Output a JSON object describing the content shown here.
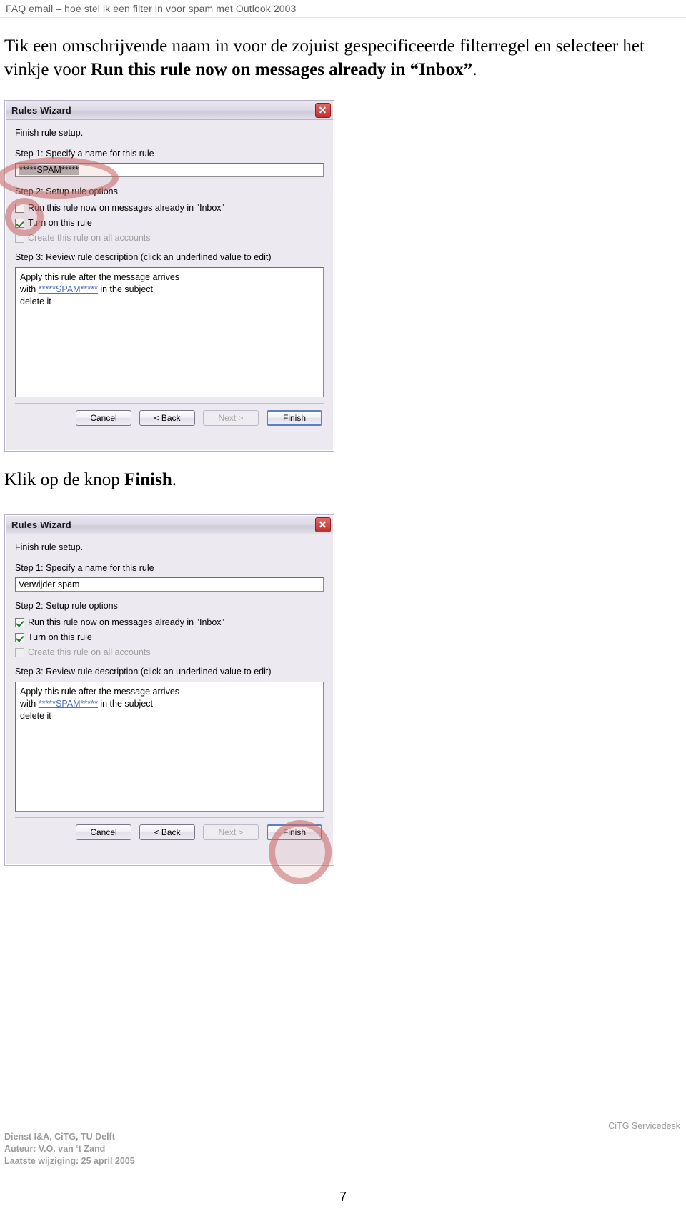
{
  "document": {
    "running_head": "FAQ email – hoe stel ik een filter in voor spam met Outlook 2003",
    "page_number": "7"
  },
  "prose": {
    "intro_part1": "Tik een omschrijvende naam in voor de zojuist gespecificeerde filterregel en selecteer het vinkje voor ",
    "intro_bold": "Run this rule now on messages already in “Inbox”",
    "intro_part2": ".",
    "klik_part1": "Klik op de knop ",
    "klik_bold": "Finish",
    "klik_part2": "."
  },
  "dialog1": {
    "title": "Rules Wizard",
    "close_label": "Close",
    "heading": "Finish rule setup.",
    "step1_label": "Step 1: Specify a name for this rule",
    "name_value": "*****SPAM*****",
    "step2_label": "Step 2: Setup rule options",
    "opt_run_now": "Run this rule now on messages already in \"Inbox\"",
    "opt_turn_on": "Turn on this rule",
    "opt_all_accounts": "Create this rule on all accounts",
    "step3_label": "Step 3: Review rule description (click an underlined value to edit)",
    "desc_line1": "Apply this rule after the message arrives",
    "desc_line2_pre": "with ",
    "desc_line2_link": "*****SPAM*****",
    "desc_line2_post": " in the subject",
    "desc_line3": "delete it",
    "btn_cancel": "Cancel",
    "btn_back": "< Back",
    "btn_next": "Next >",
    "btn_finish": "Finish"
  },
  "dialog2": {
    "title": "Rules Wizard",
    "close_label": "Close",
    "heading": "Finish rule setup.",
    "step1_label": "Step 1: Specify a name for this rule",
    "name_value": "Verwijder spam",
    "step2_label": "Step 2: Setup rule options",
    "opt_run_now": "Run this rule now on messages already in \"Inbox\"",
    "opt_turn_on": "Turn on this rule",
    "opt_all_accounts": "Create this rule on all accounts",
    "step3_label": "Step 3: Review rule description (click an underlined value to edit)",
    "desc_line1": "Apply this rule after the message arrives",
    "desc_line2_pre": "with ",
    "desc_line2_link": "*****SPAM*****",
    "desc_line2_post": " in the subject",
    "desc_line3": "delete it",
    "btn_cancel": "Cancel",
    "btn_back": "< Back",
    "btn_next": "Next >",
    "btn_finish": "Finish"
  },
  "footer": {
    "line1": "Dienst I&A, CiTG, TU Delft",
    "line2": "Auteur: V.O. van ‘t Zand",
    "line3": "Laatste wijziging: 25 april 2005",
    "right": "CiTG Servicedesk"
  },
  "colors": {
    "accent_marker": "#c46868",
    "link": "#4b6fbd",
    "check": "#1c7a27"
  }
}
